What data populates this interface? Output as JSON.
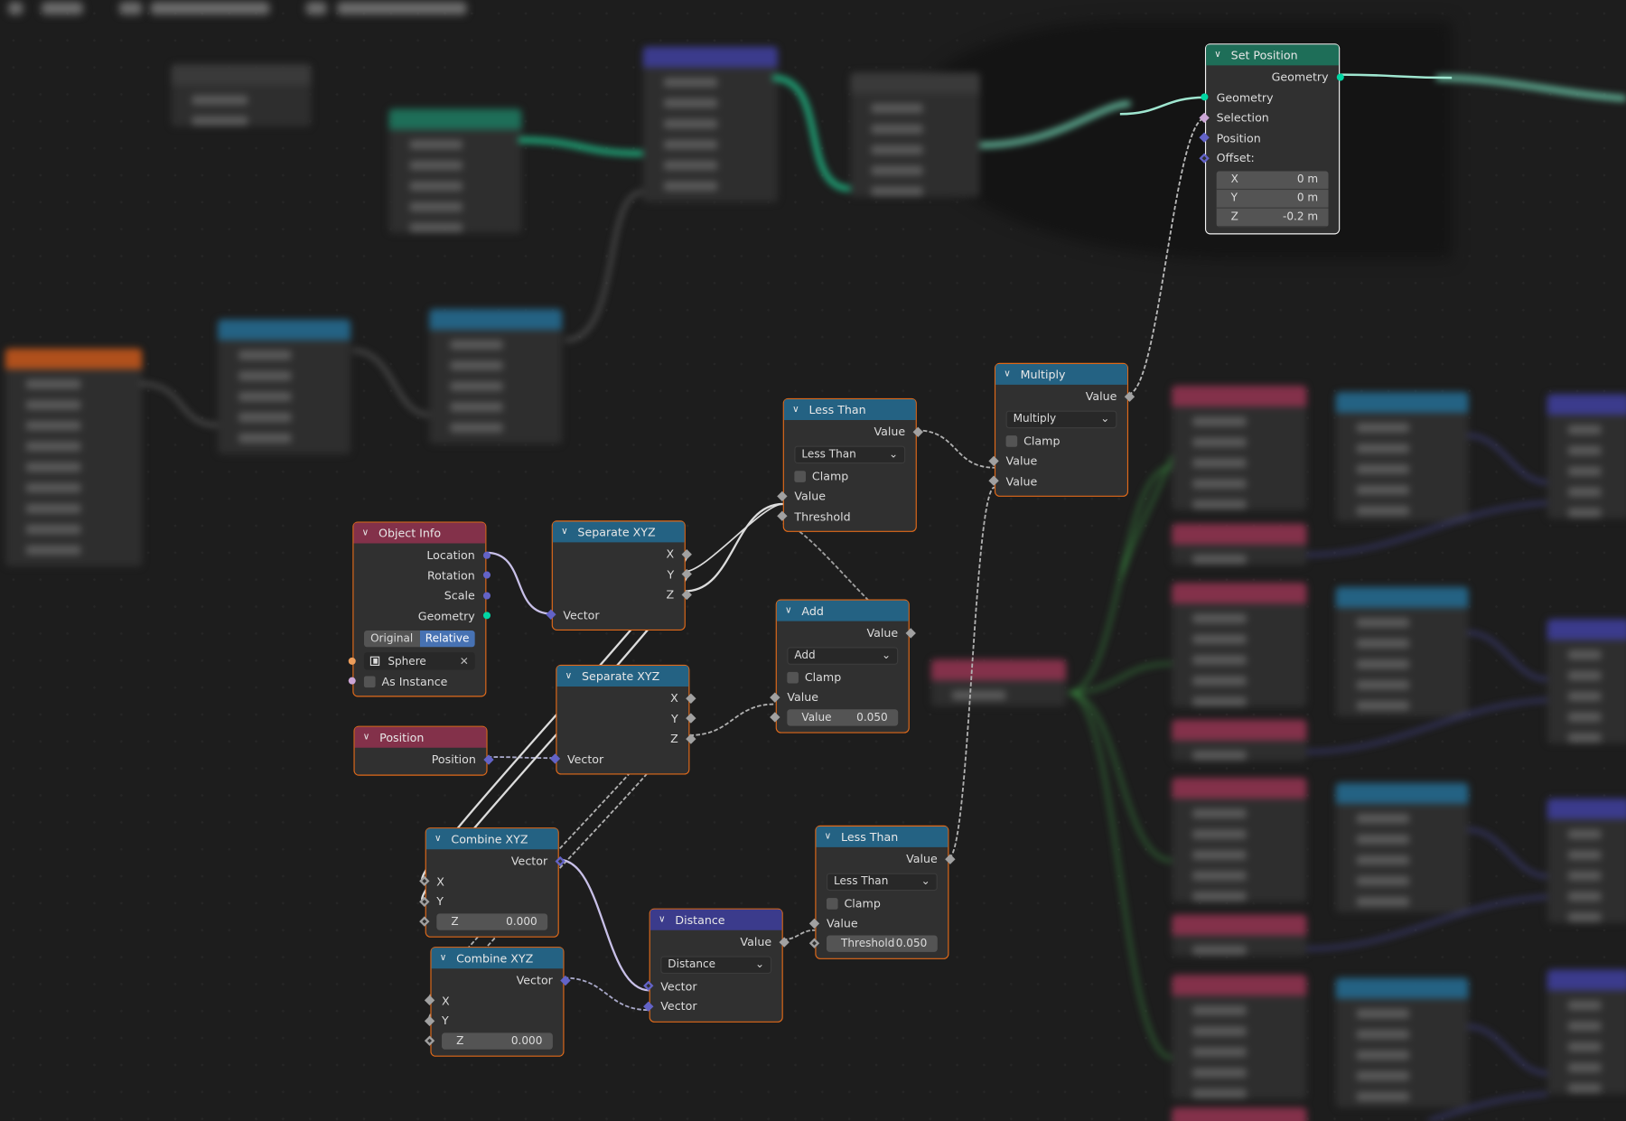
{
  "colors": {
    "geometry": "#00d6a3",
    "vector": "#6363c7",
    "float": "#a1a1a1",
    "bool": "#cca6d6",
    "object": "#ed9e5c",
    "header_geometry": "#1e6e58",
    "header_math": "#246283",
    "header_input": "#83314a",
    "header_vector": "#3b3b8c",
    "wire": "#c8c8d8",
    "selected_border": "#e06a1a"
  },
  "nodes": [
    {
      "id": "set_position",
      "title": "Set Position",
      "header": "header_geometry",
      "rows": [
        {
          "t": "out",
          "label": "Geometry",
          "sock": "geometry",
          "shape": "circle"
        },
        {
          "t": "in",
          "label": "Geometry",
          "sock": "geometry",
          "shape": "circle"
        },
        {
          "t": "in",
          "label": "Selection",
          "sock": "bool",
          "shape": "diamond"
        },
        {
          "t": "in",
          "label": "Position",
          "sock": "vector",
          "shape": "diamond"
        },
        {
          "t": "in",
          "label": "Offset:",
          "sock": "vector",
          "shape": "diamond",
          "dot": true
        },
        {
          "t": "vec",
          "items": [
            {
              "k": "X",
              "v": "0 m"
            },
            {
              "k": "Y",
              "v": "0 m"
            },
            {
              "k": "Z",
              "v": "-0.2 m"
            }
          ]
        }
      ]
    },
    {
      "id": "multiply",
      "title": "Multiply",
      "header": "header_math",
      "rows": [
        {
          "t": "out",
          "label": "Value",
          "sock": "float",
          "shape": "diamond"
        },
        {
          "t": "select",
          "label": "Multiply"
        },
        {
          "t": "check",
          "label": "Clamp"
        },
        {
          "t": "in",
          "label": "Value",
          "sock": "float",
          "shape": "diamond"
        },
        {
          "t": "in",
          "label": "Value",
          "sock": "float",
          "shape": "diamond"
        }
      ]
    },
    {
      "id": "less_than_1",
      "title": "Less Than",
      "header": "header_math",
      "rows": [
        {
          "t": "out",
          "label": "Value",
          "sock": "float",
          "shape": "diamond"
        },
        {
          "t": "select",
          "label": "Less Than"
        },
        {
          "t": "check",
          "label": "Clamp"
        },
        {
          "t": "in",
          "label": "Value",
          "sock": "float",
          "shape": "diamond"
        },
        {
          "t": "in",
          "label": "Threshold",
          "sock": "float",
          "shape": "diamond"
        }
      ]
    },
    {
      "id": "object_info",
      "title": "Object Info",
      "header": "header_input",
      "rows": [
        {
          "t": "out",
          "label": "Location",
          "sock": "vector",
          "shape": "circle"
        },
        {
          "t": "out",
          "label": "Rotation",
          "sock": "vector",
          "shape": "circle"
        },
        {
          "t": "out",
          "label": "Scale",
          "sock": "vector",
          "shape": "circle"
        },
        {
          "t": "out",
          "label": "Geometry",
          "sock": "geometry",
          "shape": "circle"
        },
        {
          "t": "toggle",
          "options": [
            "Original",
            "Relative"
          ],
          "active": 1
        },
        {
          "t": "object",
          "label": "Sphere",
          "sock": "object"
        },
        {
          "t": "checkin",
          "label": "As Instance",
          "sock": "bool"
        }
      ]
    },
    {
      "id": "separate_xyz_1",
      "title": "Separate XYZ",
      "header": "header_math",
      "rows": [
        {
          "t": "out",
          "label": "X",
          "sock": "float",
          "shape": "diamond"
        },
        {
          "t": "out",
          "label": "Y",
          "sock": "float",
          "shape": "diamond"
        },
        {
          "t": "out",
          "label": "Z",
          "sock": "float",
          "shape": "diamond"
        },
        {
          "t": "in",
          "label": "Vector",
          "sock": "vector",
          "shape": "diamond"
        }
      ]
    },
    {
      "id": "separate_xyz_2",
      "title": "Separate XYZ",
      "header": "header_math",
      "rows": [
        {
          "t": "out",
          "label": "X",
          "sock": "float",
          "shape": "diamond"
        },
        {
          "t": "out",
          "label": "Y",
          "sock": "float",
          "shape": "diamond"
        },
        {
          "t": "out",
          "label": "Z",
          "sock": "float",
          "shape": "diamond"
        },
        {
          "t": "in",
          "label": "Vector",
          "sock": "vector",
          "shape": "diamond"
        }
      ]
    },
    {
      "id": "add",
      "title": "Add",
      "header": "header_math",
      "rows": [
        {
          "t": "out",
          "label": "Value",
          "sock": "float",
          "shape": "diamond"
        },
        {
          "t": "select",
          "label": "Add"
        },
        {
          "t": "check",
          "label": "Clamp"
        },
        {
          "t": "in",
          "label": "Value",
          "sock": "float",
          "shape": "diamond"
        },
        {
          "t": "field",
          "label": "Value",
          "value": "0.050",
          "sock": "float"
        }
      ]
    },
    {
      "id": "position",
      "title": "Position",
      "header": "header_input",
      "rows": [
        {
          "t": "out",
          "label": "Position",
          "sock": "vector",
          "shape": "diamond"
        }
      ]
    },
    {
      "id": "combine_xyz_1",
      "title": "Combine XYZ",
      "header": "header_math",
      "rows": [
        {
          "t": "out",
          "label": "Vector",
          "sock": "vector",
          "shape": "diamond",
          "dot": true
        },
        {
          "t": "in",
          "label": "X",
          "sock": "float",
          "shape": "diamond",
          "dot": true
        },
        {
          "t": "in",
          "label": "Y",
          "sock": "float",
          "shape": "diamond",
          "dot": true
        },
        {
          "t": "field",
          "label": "Z",
          "value": "0.000",
          "sock": "float",
          "dot": true
        }
      ]
    },
    {
      "id": "combine_xyz_2",
      "title": "Combine XYZ",
      "header": "header_math",
      "rows": [
        {
          "t": "out",
          "label": "Vector",
          "sock": "vector",
          "shape": "diamond"
        },
        {
          "t": "in",
          "label": "X",
          "sock": "float",
          "shape": "diamond"
        },
        {
          "t": "in",
          "label": "Y",
          "sock": "float",
          "shape": "diamond"
        },
        {
          "t": "field",
          "label": "Z",
          "value": "0.000",
          "sock": "float",
          "dot": true
        }
      ]
    },
    {
      "id": "distance",
      "title": "Distance",
      "header": "header_vector",
      "rows": [
        {
          "t": "out",
          "label": "Value",
          "sock": "float",
          "shape": "diamond"
        },
        {
          "t": "select",
          "label": "Distance"
        },
        {
          "t": "in",
          "label": "Vector",
          "sock": "vector",
          "shape": "diamond",
          "dot": true
        },
        {
          "t": "in",
          "label": "Vector",
          "sock": "vector",
          "shape": "diamond"
        }
      ]
    },
    {
      "id": "less_than_2",
      "title": "Less Than",
      "header": "header_math",
      "rows": [
        {
          "t": "out",
          "label": "Value",
          "sock": "float",
          "shape": "diamond"
        },
        {
          "t": "select",
          "label": "Less Than"
        },
        {
          "t": "check",
          "label": "Clamp"
        },
        {
          "t": "in",
          "label": "Value",
          "sock": "float",
          "shape": "diamond"
        },
        {
          "t": "field",
          "label": "Threshold",
          "value": "0.050",
          "sock": "float",
          "dot": true
        }
      ]
    }
  ]
}
